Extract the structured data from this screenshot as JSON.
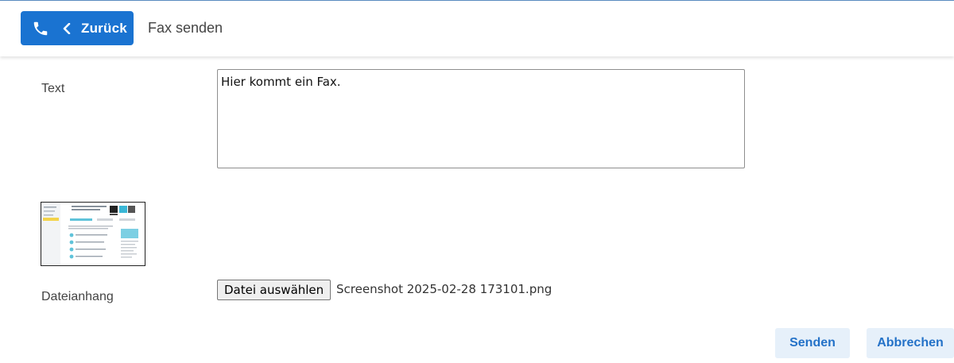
{
  "header": {
    "back_label": "Zurück",
    "title": "Fax senden"
  },
  "form": {
    "text_label": "Text",
    "text_value": "Hier kommt ein Fax.",
    "attachment_label": "Dateianhang",
    "file_button_label": "Datei auswählen",
    "file_name": "Screenshot 2025-02-28 173101.png"
  },
  "actions": {
    "send_label": "Senden",
    "cancel_label": "Abbrechen"
  },
  "colors": {
    "accent": "#1a73d1",
    "secondary_button_bg": "#e6f0fa",
    "secondary_button_text": "#2472c8"
  },
  "icons": {
    "phone": "phone-icon",
    "back": "chevron-left-icon"
  }
}
